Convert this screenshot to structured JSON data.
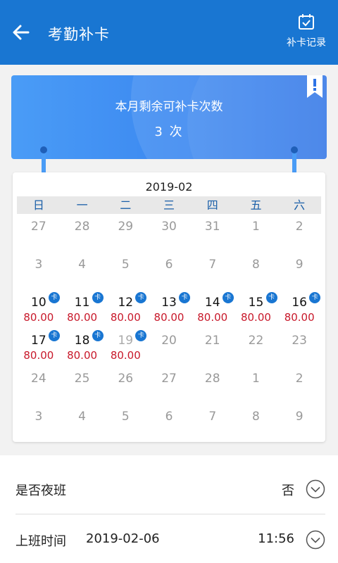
{
  "header": {
    "title": "考勤补卡",
    "history_label": "补卡记录"
  },
  "banner": {
    "label": "本月剩余可补卡次数",
    "count": "3 次"
  },
  "calendar": {
    "month": "2019-02",
    "weekdays": [
      "日",
      "一",
      "二",
      "三",
      "四",
      "五",
      "六"
    ],
    "badge_label": "卡",
    "weeks": [
      [
        {
          "d": "27",
          "t": "other"
        },
        {
          "d": "28",
          "t": "other"
        },
        {
          "d": "29",
          "t": "other"
        },
        {
          "d": "30",
          "t": "other"
        },
        {
          "d": "31",
          "t": "other"
        },
        {
          "d": "1",
          "t": "other"
        },
        {
          "d": "2",
          "t": "other"
        }
      ],
      [
        {
          "d": "3",
          "t": "other"
        },
        {
          "d": "4",
          "t": "other"
        },
        {
          "d": "5",
          "t": "other"
        },
        {
          "d": "6",
          "t": "other"
        },
        {
          "d": "7",
          "t": "other"
        },
        {
          "d": "8",
          "t": "other"
        },
        {
          "d": "9",
          "t": "other"
        }
      ],
      [
        {
          "d": "10",
          "t": "cur",
          "amt": "80.00",
          "badge": true
        },
        {
          "d": "11",
          "t": "cur",
          "amt": "80.00",
          "badge": true
        },
        {
          "d": "12",
          "t": "cur",
          "amt": "80.00",
          "badge": true
        },
        {
          "d": "13",
          "t": "cur",
          "amt": "80.00",
          "badge": true
        },
        {
          "d": "14",
          "t": "cur",
          "amt": "80.00",
          "badge": true
        },
        {
          "d": "15",
          "t": "cur",
          "amt": "80.00",
          "badge": true
        },
        {
          "d": "16",
          "t": "cur",
          "amt": "80.00",
          "badge": true
        }
      ],
      [
        {
          "d": "17",
          "t": "cur",
          "amt": "80.00",
          "badge": true
        },
        {
          "d": "18",
          "t": "cur",
          "amt": "80.00",
          "badge": true
        },
        {
          "d": "19",
          "t": "dim",
          "amt": "80.00",
          "badge": true
        },
        {
          "d": "20",
          "t": "other"
        },
        {
          "d": "21",
          "t": "other"
        },
        {
          "d": "22",
          "t": "other"
        },
        {
          "d": "23",
          "t": "other"
        }
      ],
      [
        {
          "d": "24",
          "t": "other"
        },
        {
          "d": "25",
          "t": "other"
        },
        {
          "d": "26",
          "t": "other"
        },
        {
          "d": "27",
          "t": "other"
        },
        {
          "d": "28",
          "t": "other"
        },
        {
          "d": "1",
          "t": "other"
        },
        {
          "d": "2",
          "t": "other"
        }
      ],
      [
        {
          "d": "3",
          "t": "other"
        },
        {
          "d": "4",
          "t": "other"
        },
        {
          "d": "5",
          "t": "other"
        },
        {
          "d": "6",
          "t": "other"
        },
        {
          "d": "7",
          "t": "other"
        },
        {
          "d": "8",
          "t": "other"
        },
        {
          "d": "9",
          "t": "other"
        }
      ]
    ]
  },
  "form": {
    "night_shift_label": "是否夜班",
    "night_shift_value": "否",
    "work_time_label": "上班时间",
    "work_date": "2019-02-06",
    "work_time": "11:56"
  },
  "colors": {
    "appbar": "#1976d2",
    "amount": "#c8182a",
    "weekday_text": "#1a5fa8"
  },
  "icons": [
    "back-arrow-icon",
    "calendar-check-icon",
    "exclamation-bookmark-icon",
    "chevron-down-icon"
  ]
}
